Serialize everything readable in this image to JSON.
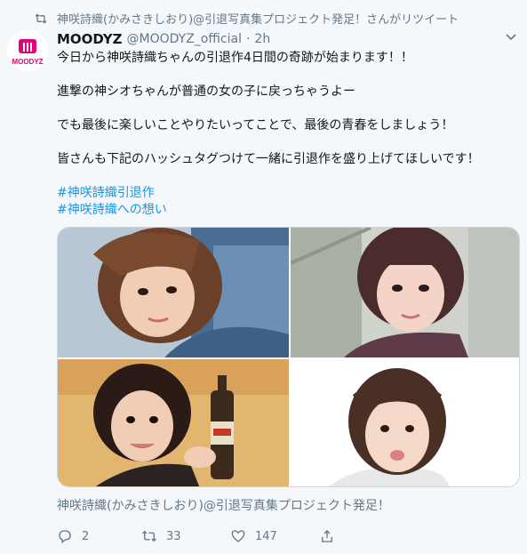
{
  "retweet_context": {
    "icon": "retweet-icon",
    "text": "神咲詩織(かみさきしおり)@引退写真集プロジェクト発足！さんがリツイート"
  },
  "tweet": {
    "avatar": {
      "logo_text": "MOODYZ",
      "brand_color": "#e4007f"
    },
    "display_name": "MOODYZ",
    "handle": "@MOODYZ_official",
    "separator": "·",
    "time": "2h",
    "lines": [
      "今日から神咲詩織ちゃんの引退作4日間の奇跡が始まります！！",
      "進撃の神シオちゃんが普通の女の子に戻っちゃうよー",
      "でも最後に楽しいことやりたいってことで、最後の青春をしましょう！",
      "皆さんも下記のハッシュタグつけて一緒に引退作を盛り上げてほしいです！"
    ],
    "hashtags": [
      "#神咲詩織引退作",
      "#神咲詩織への想い"
    ],
    "link_color": "#1b95e0",
    "photos": [
      {
        "icon": "photo-selfie-denim"
      },
      {
        "icon": "photo-portrait-window"
      },
      {
        "icon": "photo-bottle-toast"
      },
      {
        "icon": "photo-pout-face"
      }
    ],
    "footer_link": "神咲詩織(かみさきしおり)@引退写真集プロジェクト発足！",
    "actions": {
      "reply_count": "2",
      "retweet_count": "33",
      "like_count": "147"
    }
  }
}
